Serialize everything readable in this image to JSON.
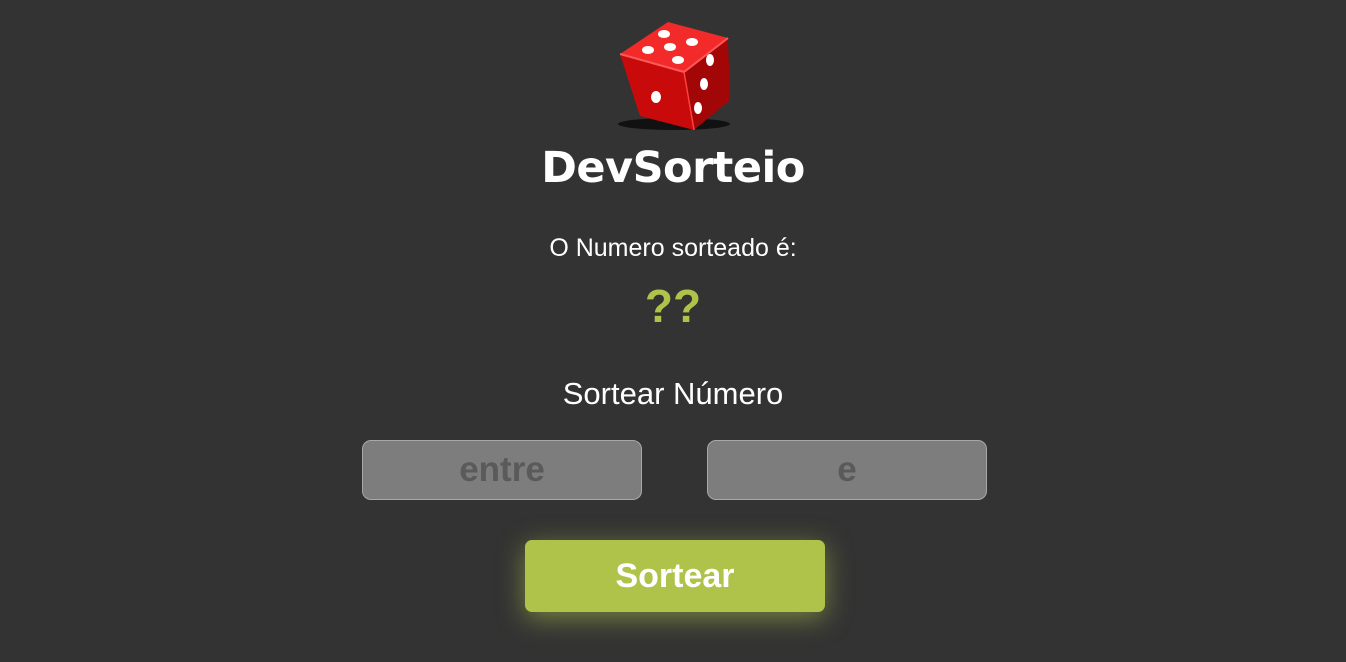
{
  "app": {
    "title": "DevSorteio",
    "logo_icon": "red-dice-icon"
  },
  "result": {
    "label": "O Numero sorteado é:",
    "value": "??"
  },
  "draw_section": {
    "title": "Sortear Número",
    "min_input": {
      "placeholder": "entre",
      "value": ""
    },
    "max_input": {
      "placeholder": "e",
      "value": ""
    },
    "button_label": "Sortear"
  },
  "colors": {
    "background": "#333333",
    "accent": "#afc34a",
    "input_bg": "#7d7d7d",
    "dice_red": "#e01010"
  }
}
